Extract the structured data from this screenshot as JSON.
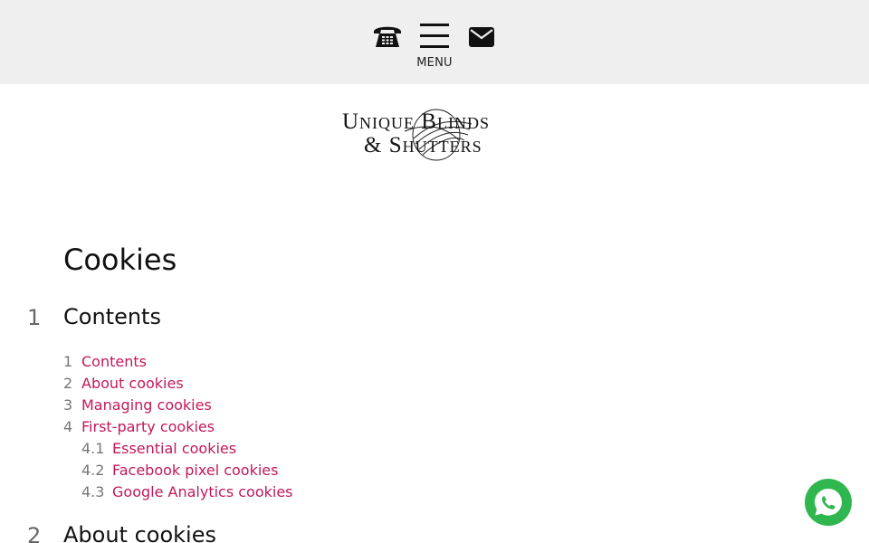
{
  "header": {
    "menu_label": "MENU",
    "icons": {
      "phone": "phone-icon",
      "menu": "hamburger-menu-icon",
      "mail": "mail-icon"
    }
  },
  "logo": {
    "line1": "Unique Blinds",
    "line2": "& Shutters"
  },
  "page": {
    "title": "Cookies"
  },
  "sections": [
    {
      "number": "1",
      "title": "Contents"
    },
    {
      "number": "2",
      "title": "About cookies"
    }
  ],
  "toc": [
    {
      "number": "1",
      "label": "Contents"
    },
    {
      "number": "2",
      "label": "About cookies"
    },
    {
      "number": "3",
      "label": "Managing cookies"
    },
    {
      "number": "4",
      "label": "First-party cookies"
    },
    {
      "number": "4.1",
      "label": "Essential cookies"
    },
    {
      "number": "4.2",
      "label": "Facebook pixel cookies"
    },
    {
      "number": "4.3",
      "label": "Google Analytics cookies"
    }
  ],
  "floating": {
    "whatsapp_icon": "whatsapp-icon"
  },
  "colors": {
    "link": "#c2185b",
    "topbar": "#efefef",
    "whatsapp": "#2fb64e"
  }
}
